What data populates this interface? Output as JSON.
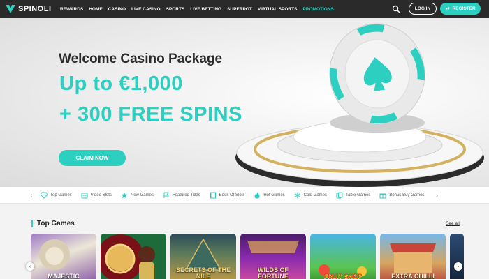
{
  "brand": {
    "name": "SPINOLI",
    "accent": "#2ccfc0",
    "topbar_bg": "#2a2a2a"
  },
  "nav": [
    "REWARDS",
    "HOME",
    "CASINO",
    "LIVE CASINO",
    "SPORTS",
    "LIVE BETTING",
    "SUPERPOT",
    "VIRTUAL SPORTS",
    "PROMOTIONS"
  ],
  "auth": {
    "login": "LOG IN",
    "register": "REGISTER"
  },
  "hero": {
    "title": "Welcome Casino Package",
    "line1": "Up to €1,000",
    "line2": "+ 300 FREE SPINS",
    "cta": "CLAIM NOW"
  },
  "categories": [
    {
      "label": "Top Games",
      "icon": "diamond-icon"
    },
    {
      "label": "Video Slots",
      "icon": "slot-machine-icon"
    },
    {
      "label": "New Games",
      "icon": "star-icon"
    },
    {
      "label": "Featured Titles",
      "icon": "flag-icon"
    },
    {
      "label": "Book Of Slots",
      "icon": "book-icon"
    },
    {
      "label": "Hot Games",
      "icon": "flame-icon"
    },
    {
      "label": "Cold Games",
      "icon": "snowflake-icon"
    },
    {
      "label": "Table Games",
      "icon": "cards-icon"
    },
    {
      "label": "Bonus Buy Games",
      "icon": "gift-icon"
    }
  ],
  "section": {
    "title": "Top Games",
    "see_all": "See all"
  },
  "games": [
    {
      "title": "MAJESTIC",
      "name": "game-majestic"
    },
    {
      "title": "",
      "name": "game-roulette"
    },
    {
      "title": "SECRETS OF THE NILE",
      "name": "game-secrets-nile"
    },
    {
      "title": "WILDS OF FORTUNE",
      "name": "game-wilds-fortune"
    },
    {
      "title": "FRUIT SHOP",
      "name": "game-fruit-shop"
    },
    {
      "title": "EXTRA CHILLI",
      "name": "game-extra-chilli"
    }
  ]
}
